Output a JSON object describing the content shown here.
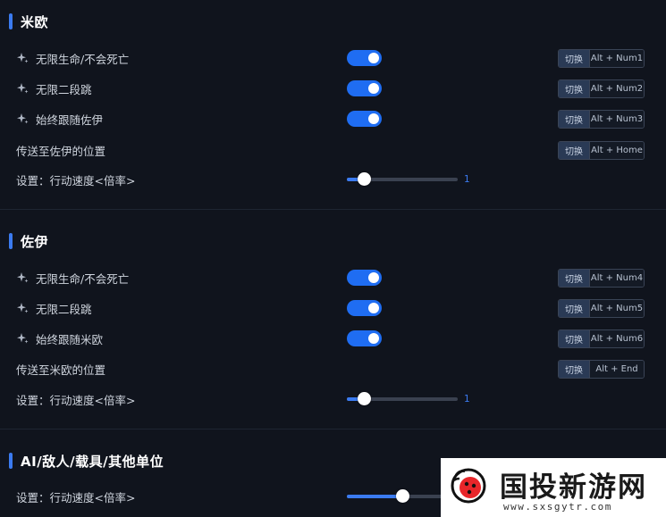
{
  "sections": [
    {
      "title": "米欧",
      "toggles": [
        {
          "label": "无限生命/不会死亡",
          "on": true,
          "switch_label": "切换",
          "hotkey": "Alt + Num1"
        },
        {
          "label": "无限二段跳",
          "on": true,
          "switch_label": "切换",
          "hotkey": "Alt + Num2"
        },
        {
          "label": "始终跟随佐伊",
          "on": true,
          "switch_label": "切换",
          "hotkey": "Alt + Num3"
        }
      ],
      "action": {
        "label": "传送至佐伊的位置",
        "switch_label": "切换",
        "hotkey": "Alt + Home"
      },
      "slider": {
        "label": "设置：行动速度<倍率>",
        "value": "1",
        "fraction": 0.155
      }
    },
    {
      "title": "佐伊",
      "toggles": [
        {
          "label": "无限生命/不会死亡",
          "on": true,
          "switch_label": "切换",
          "hotkey": "Alt + Num4"
        },
        {
          "label": "无限二段跳",
          "on": true,
          "switch_label": "切换",
          "hotkey": "Alt + Num5"
        },
        {
          "label": "始终跟随米欧",
          "on": true,
          "switch_label": "切换",
          "hotkey": "Alt + Num6"
        }
      ],
      "action": {
        "label": "传送至米欧的位置",
        "switch_label": "切换",
        "hotkey": "Alt + End"
      },
      "slider": {
        "label": "设置：行动速度<倍率>",
        "value": "1",
        "fraction": 0.155
      }
    },
    {
      "title": "AI/敌人/载具/其他单位",
      "slider": {
        "label": "设置：行动速度<倍率>",
        "fraction": 0.5
      }
    }
  ],
  "watermark": {
    "title": "国投新游网",
    "url": "www.sxsgytr.com"
  },
  "icons": {
    "feature": "sparkle-icon"
  },
  "colors": {
    "accent": "#3b7bf0",
    "toggle_on": "#1f6df2",
    "background": "#10141d"
  }
}
